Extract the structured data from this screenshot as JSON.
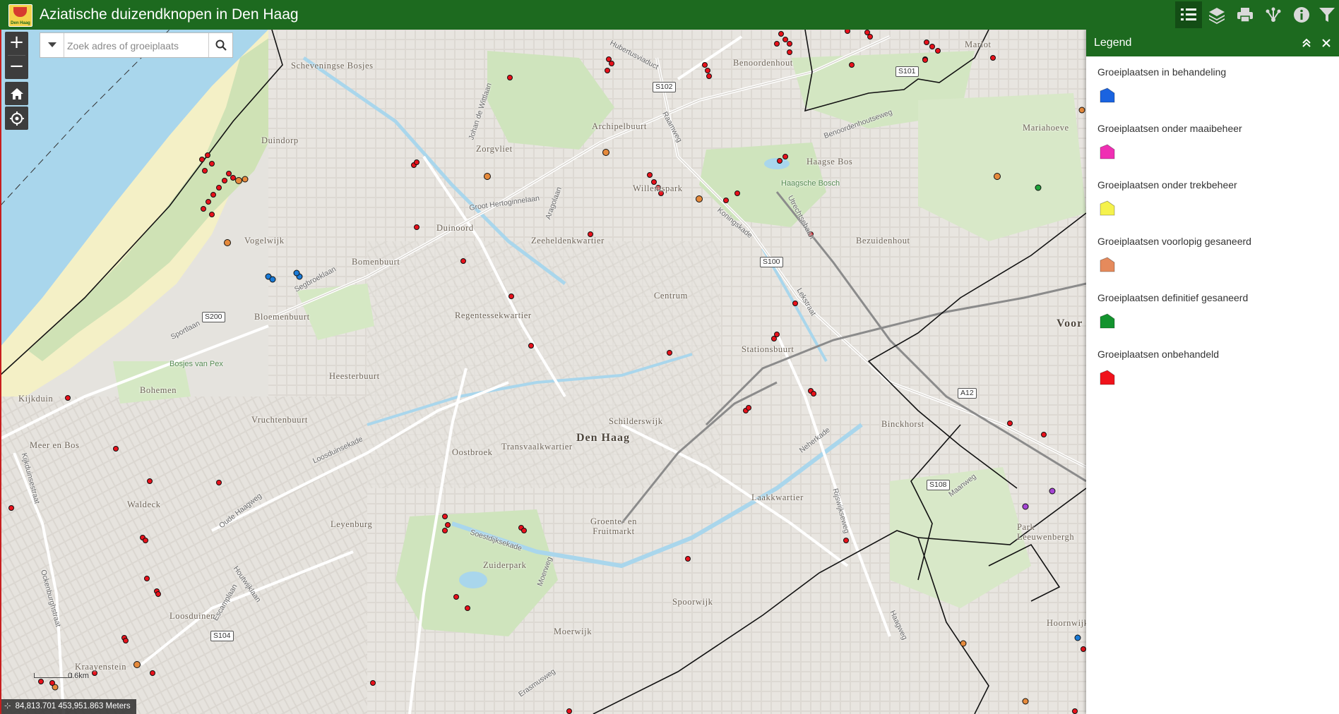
{
  "header": {
    "title": "Aziatische duizendknopen in Den Haag",
    "logo_text": "Den Haag",
    "tools": [
      {
        "name": "legend-tool",
        "icon": "list-icon",
        "active": true
      },
      {
        "name": "layers-tool",
        "icon": "layers-icon"
      },
      {
        "name": "print-tool",
        "icon": "printer-icon"
      },
      {
        "name": "share-tool",
        "icon": "share-icon"
      },
      {
        "name": "about-tool",
        "icon": "info-icon"
      },
      {
        "name": "filter-tool",
        "icon": "filter-icon"
      }
    ]
  },
  "search": {
    "placeholder": "Zoek adres of groeiplaats"
  },
  "map_controls": {
    "zoom_in": "+",
    "zoom_out": "−",
    "home_icon": "home-icon",
    "locate_icon": "locate-icon"
  },
  "scalebar": {
    "label": "0.6km"
  },
  "coordinates": {
    "text": "84,813.701 453,951.863 Meters"
  },
  "map_labels": {
    "neighbourhoods": [
      "Scheveningse Bosjes",
      "Benoordenhout",
      "Marlot",
      "Duindorp",
      "Zorgvliet",
      "Archipelbuurt",
      "Mariahoeve",
      "Haagse Bos",
      "Willemspark",
      "Duinoord",
      "Vogelwijk",
      "Zeeheldenkwartier",
      "Bezuidenhout",
      "Bomenbuurt",
      "Centrum",
      "Bloemenbuurt",
      "Regentessekwartier",
      "Stationsbuurt",
      "Voor",
      "Heesterbuurt",
      "Bohemen",
      "Kijkduin",
      "Vruchtenbuurt",
      "Schilderswijk",
      "Den Haag",
      "Binckhorst",
      "Meer en Bos",
      "Oostbroek",
      "Transvaalkwartier",
      "Waldeck",
      "Laakkwartier",
      "Leyenburg",
      "Groente- en Fruitmarkt",
      "Park Leeuwenbergh",
      "Zuiderpark",
      "Loosduinen",
      "Spoorwijk",
      "Moerwijk",
      "Kraayenstein",
      "Hoornwijk"
    ],
    "green_areas": [
      "Bosjes van Pex",
      "Haagsche Bosch"
    ],
    "streets": [
      "Hubertusviaduct",
      "Johan de Wittlaan",
      "Raamweg",
      "Benoordenhoutseweg",
      "Groot Hertoginnelaan",
      "Segbroeklaan",
      "Sportlaan",
      "Koningskade",
      "Utrechtsebaan",
      "Lekstraat",
      "Loosduinsekade",
      "Oude Haagweg",
      "Kijkduinsestraat",
      "Ockenburghstraat",
      "Houtwijklaan",
      "Escamplaan",
      "Soestdijksekade",
      "Moerweg",
      "Erasmusweg",
      "Neherkade",
      "Rijswijkseweg",
      "Haagweg",
      "Maanweg",
      "Aragolaan"
    ],
    "road_shields": [
      "S102",
      "S101",
      "S100",
      "S200",
      "A12",
      "S108",
      "S104"
    ]
  },
  "legend": {
    "title": "Legend",
    "collapse_icon": "chevron-double-up-icon",
    "close_icon": "close-icon",
    "items": [
      {
        "label": "Groeiplaatsen in behandeling",
        "color": "#1a63e0"
      },
      {
        "label": "Groeiplaatsen onder maaibeheer",
        "color": "#ef2fb3"
      },
      {
        "label": "Groeiplaatsen onder trekbeheer",
        "color": "#f5f24c"
      },
      {
        "label": "Groeiplaatsen voorlopig gesaneerd",
        "color": "#e58a5c"
      },
      {
        "label": "Groeiplaatsen definitief gesaneerd",
        "color": "#13932e"
      },
      {
        "label": "Groeiplaatsen onbehandeld",
        "color": "#f0121b"
      }
    ]
  }
}
